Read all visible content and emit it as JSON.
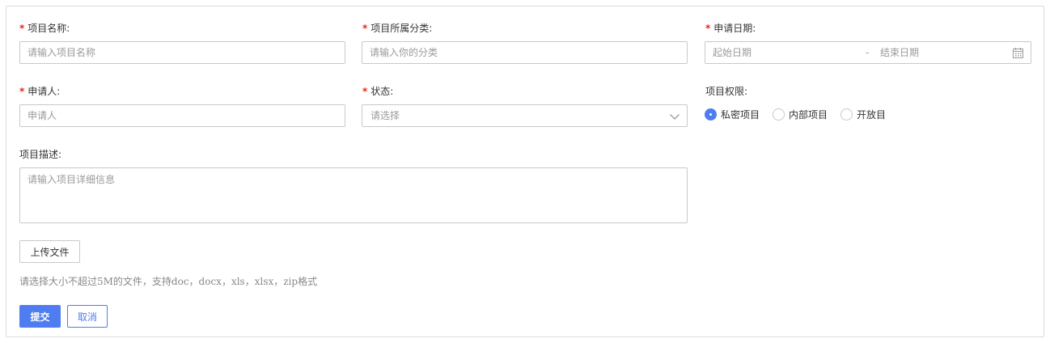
{
  "form": {
    "project_name": {
      "label": "项目名称:",
      "required_mark": "*",
      "placeholder": "请输入项目名称"
    },
    "project_category": {
      "label": "项目所属分类:",
      "required_mark": "*",
      "placeholder": "请输入你的分类"
    },
    "apply_date": {
      "label": "申请日期:",
      "required_mark": "*",
      "start_placeholder": "起始日期",
      "separator": "-",
      "end_placeholder": "结束日期",
      "icon": "calendar-icon"
    },
    "applicant": {
      "label": "申请人:",
      "required_mark": "*",
      "placeholder": "申请人"
    },
    "status": {
      "label": "状态:",
      "required_mark": "*",
      "placeholder": "请选择",
      "icon": "chevron-down-icon"
    },
    "permission": {
      "label": "项目权限:",
      "options": [
        {
          "label": "私密项目",
          "checked": true
        },
        {
          "label": "内部项目",
          "checked": false
        },
        {
          "label": "开放目",
          "checked": false
        }
      ]
    },
    "description": {
      "label": "项目描述:",
      "placeholder": "请输入项目详细信息"
    },
    "upload": {
      "button_label": "上传文件",
      "hint": "请选择大小不超过5M的文件，支持doc，docx，xls，xlsx，zip格式"
    },
    "actions": {
      "submit_label": "提交",
      "cancel_label": "取消"
    }
  },
  "colors": {
    "accent": "#4f7cf0",
    "required": "#e5261a",
    "border": "#c9c9c9",
    "placeholder": "#9a9a9a"
  }
}
